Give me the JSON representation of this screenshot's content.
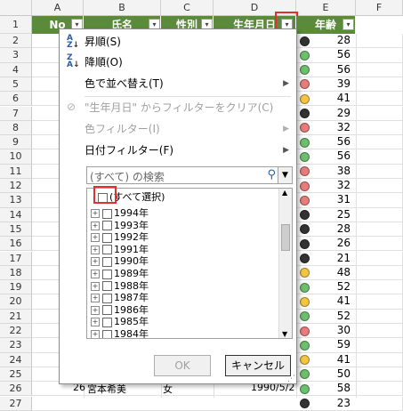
{
  "columns": [
    "A",
    "B",
    "C",
    "D",
    "E",
    "F"
  ],
  "headers": {
    "no": "No",
    "name": "氏名",
    "gender": "性別",
    "birth": "生年月日",
    "age": "年齢"
  },
  "rows": [
    {
      "n": "1"
    },
    {
      "n": "2",
      "age": "28",
      "dot": "#333333"
    },
    {
      "n": "3",
      "age": "56",
      "dot": "#6cbf6c"
    },
    {
      "n": "4",
      "age": "56",
      "dot": "#6cbf6c"
    },
    {
      "n": "5",
      "age": "39",
      "dot": "#e87b7b"
    },
    {
      "n": "6",
      "age": "41",
      "dot": "#f5c542"
    },
    {
      "n": "7",
      "age": "29",
      "dot": "#333333"
    },
    {
      "n": "8",
      "age": "32",
      "dot": "#e87b7b"
    },
    {
      "n": "9",
      "age": "56",
      "dot": "#6cbf6c"
    },
    {
      "n": "10",
      "age": "56",
      "dot": "#6cbf6c"
    },
    {
      "n": "11",
      "age": "38",
      "dot": "#e87b7b"
    },
    {
      "n": "12",
      "age": "32",
      "dot": "#e87b7b"
    },
    {
      "n": "13",
      "age": "31",
      "dot": "#e87b7b"
    },
    {
      "n": "14",
      "age": "25",
      "dot": "#333333"
    },
    {
      "n": "15",
      "age": "28",
      "dot": "#333333"
    },
    {
      "n": "16",
      "age": "26",
      "dot": "#333333"
    },
    {
      "n": "17",
      "age": "21",
      "dot": "#333333"
    },
    {
      "n": "18",
      "age": "48",
      "dot": "#f5c542"
    },
    {
      "n": "19",
      "age": "52",
      "dot": "#6cbf6c"
    },
    {
      "n": "20",
      "age": "41",
      "dot": "#f5c542"
    },
    {
      "n": "21",
      "age": "52",
      "dot": "#6cbf6c"
    },
    {
      "n": "22",
      "age": "30",
      "dot": "#e87b7b"
    },
    {
      "n": "23",
      "age": "59",
      "dot": "#6cbf6c"
    },
    {
      "n": "24",
      "age": "41",
      "dot": "#f5c542"
    },
    {
      "n": "25",
      "age": "50",
      "dot": "#6cbf6c"
    },
    {
      "n": "26",
      "age": "58",
      "dot": "#6cbf6c"
    },
    {
      "n": "27",
      "age": "23",
      "dot": "#333333"
    }
  ],
  "bottom_row": {
    "no": "26",
    "name": "宮本希美",
    "gender": "女",
    "birth": "1990/5/2"
  },
  "menu": {
    "sort_asc": "昇順(S)",
    "sort_desc": "降順(O)",
    "sort_color": "色で並べ替え(T)",
    "clear_filter": "\"生年月日\" からフィルターをクリア(C)",
    "color_filter": "色フィルター(I)",
    "date_filter": "日付フィルター(F)",
    "search_placeholder": "(すべて) の検索",
    "select_all": "(すべて選択)",
    "years": [
      "1994年",
      "1993年",
      "1992年",
      "1991年",
      "1990年",
      "1989年",
      "1988年",
      "1987年",
      "1986年",
      "1985年",
      "1984年"
    ],
    "ok": "OK",
    "cancel": "キャンセル"
  },
  "colors": {
    "header_green": "#5a8a3a",
    "highlight_red": "#e03030"
  }
}
